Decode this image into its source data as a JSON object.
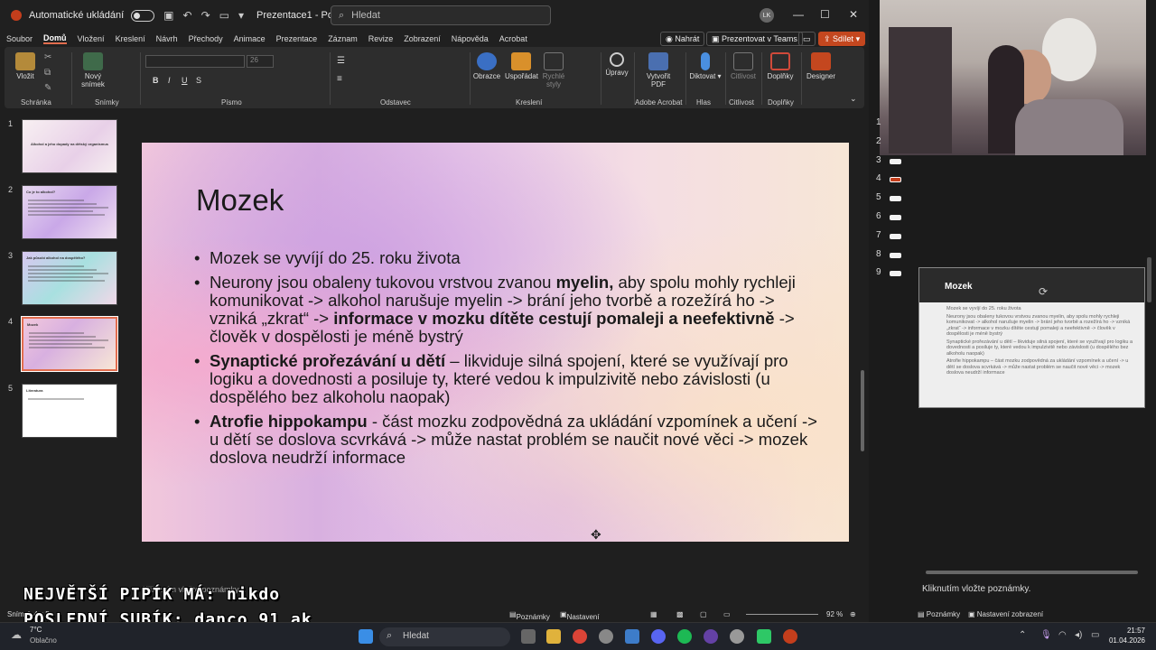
{
  "titlebar": {
    "autosave_label": "Automatické ukládání",
    "doc_title": "Prezentace1 - PowerP...",
    "search_placeholder": "Hledat",
    "avatar_initials": "LK"
  },
  "menu": {
    "items": [
      "Soubor",
      "Domů",
      "Vložení",
      "Kreslení",
      "Návrh",
      "Přechody",
      "Animace",
      "Prezentace",
      "Záznam",
      "Revize",
      "Zobrazení",
      "Nápověda",
      "Acrobat"
    ],
    "active": "Domů",
    "record_label": "Nahrát",
    "teams_label": "Prezentovat v Teams",
    "share_label": "Sdílet"
  },
  "ribbon": {
    "paste": "Vložit",
    "new_slide_1": "Nový",
    "new_slide_2": "snímek",
    "font_size": "26",
    "shapes": "Obrazce",
    "arrange": "Uspořádat",
    "quick_styles_1": "Rychlé",
    "quick_styles_2": "styly",
    "editing": "Úpravy",
    "create_pdf_1": "Vytvořit",
    "create_pdf_2": "PDF",
    "dictate": "Diktovat",
    "sensitivity": "Citlivost",
    "addins": "Doplňky",
    "designer": "Designer",
    "groups": {
      "clipboard": "Schránka",
      "slides": "Snímky",
      "font": "Písmo",
      "paragraph": "Odstavec",
      "drawing": "Kreslení",
      "adobe": "Adobe Acrobat",
      "voice": "Hlas",
      "sensitivity": "Citlivost",
      "addins": "Doplňky"
    }
  },
  "thumbnails": [
    {
      "num": "1",
      "title": "Alkohol a jeho dopady na dětský organismus"
    },
    {
      "num": "2",
      "title": "Co je to alkohol?"
    },
    {
      "num": "3",
      "title": "Jak působí alkohol na dospělého?"
    },
    {
      "num": "4",
      "title": "Mozek"
    },
    {
      "num": "5",
      "title": "Literatura"
    }
  ],
  "slide": {
    "title": "Mozek",
    "bullets": [
      {
        "pre": "Mozek se vyvíjí do 25. roku života"
      },
      {
        "pre": "Neurony jsou obaleny tukovou vrstvou zvanou ",
        "bold1": "myelin,",
        "mid": " aby spolu mohly rychleji komunikovat -> alkohol narušuje myelin -> brání jeho tvorbě a rozežírá ho -> vzniká „zkrat“ -> ",
        "bold2": "informace v mozku dítěte cestují pomaleji a neefektivně",
        "post": " -> člověk v dospělosti je méně bystrý"
      },
      {
        "bold1": "Synaptické prořezávání u dětí",
        "mid": " – likviduje silná spojení, které se využívají pro logiku a dovednosti a posiluje ty, které vedou k impulzivitě nebo závislosti (u dospělého bez alkoholu naopak)"
      },
      {
        "bold1": "Atrofie hippokampu",
        "mid": " - část mozku zodpovědná za ukládání vzpomínek a učení -> u dětí se doslova scvrkává -> může nastat problém se naučit nové věci -> mozek doslova neudrží informace"
      }
    ]
  },
  "notes_placeholder": "Kliknutím vložte poznámky.",
  "statusbar": {
    "slide_info": "Snímek 4 z 5",
    "notes": "Poznámky",
    "view_settings": "Nastavení zobrazení",
    "zoom": "92 %"
  },
  "right_panel": {
    "slide_numbers": [
      "1",
      "2",
      "3",
      "4",
      "5",
      "6",
      "7",
      "8",
      "9"
    ],
    "preview_title": "Mozek",
    "preview_lines": [
      "Mozek se vyvíjí do 25. roku života",
      "Neurony jsou obaleny tukovou vrstvou zvanou myelin, aby spolu mohly rychleji komunikovat -> alkohol narušuje myelin -> brání jeho tvorbě a rozežírá ho -> vzniká „zkrat“ -> informace v mozku dítěte cestují pomaleji a neefektivně -> člověk v dospělosti je méně bystrý",
      "Synaptické prořezávání u dětí – likviduje silná spojení, které se využívají pro logiku a dovednosti a posiluje ty, které vedou k impulzivitě nebo závislosti (u dospělého bez alkoholu naopak)",
      "Atrofie hippokampu – část mozku zodpovědná za ukládání vzpomínek a učení -> u dětí se doslova scvrkává -> může nastat problém se naučit nové věci -> mozek doslova neudrží informace"
    ],
    "notes_placeholder": "Kliknutím vložte poznámky.",
    "notes_label": "Poznámky",
    "view_settings": "Nastavení zobrazení"
  },
  "overlay": {
    "line1": "NEJVĚTŠÍ PIPÍK MÁ: nikdo",
    "line2": "POSLEDNÍ SUBÍK: danco_91_ak"
  },
  "taskbar": {
    "weather_temp": "7°C",
    "weather_desc": "Oblačno",
    "search": "Hledat",
    "time": "21:57",
    "date": "01.04.2026"
  },
  "colors": {
    "accent": "#e26d4e",
    "ribbon_bg": "#2d2d2d",
    "app_bg": "#1f1f1f"
  }
}
